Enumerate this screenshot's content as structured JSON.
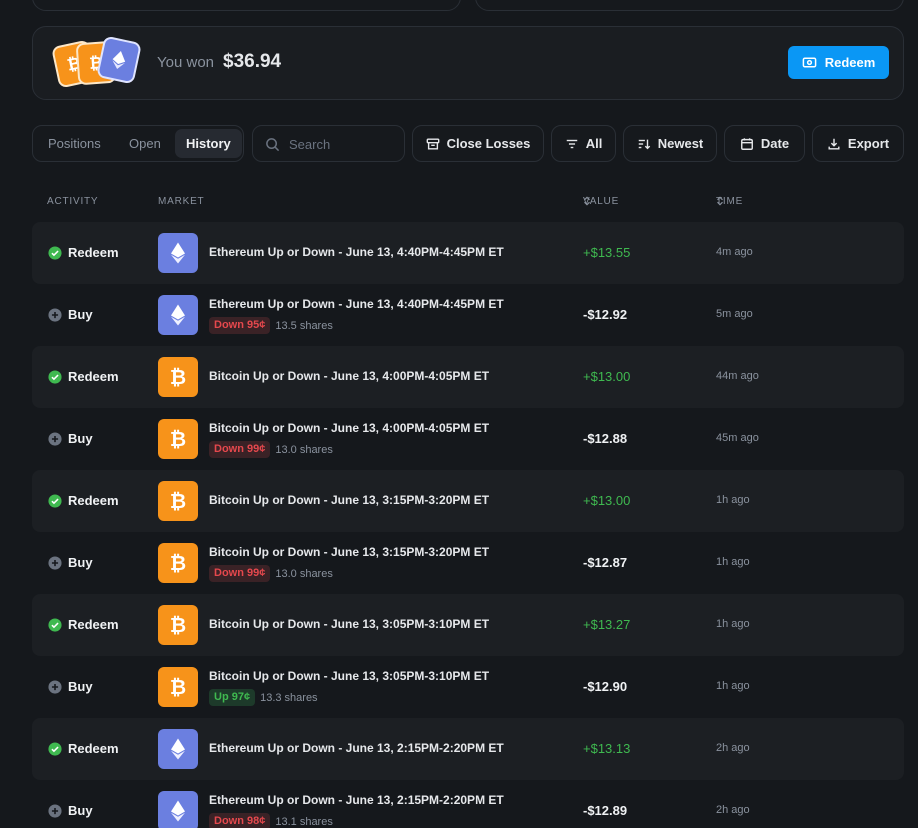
{
  "won": {
    "label": "You won",
    "amount": "$36.94",
    "redeem_label": "Redeem"
  },
  "tabs": [
    {
      "label": "Positions"
    },
    {
      "label": "Open"
    },
    {
      "label": "History"
    }
  ],
  "search": {
    "placeholder": "Search"
  },
  "toolbar": {
    "close_losses": "Close Losses",
    "all": "All",
    "newest": "Newest",
    "date": "Date",
    "export": "Export"
  },
  "table": {
    "headers": {
      "activity": "ACTIVITY",
      "market": "MARKET",
      "value": "VALUE",
      "time": "TIME"
    },
    "rows": [
      {
        "activity": "Redeem",
        "market": "Ethereum Up or Down - June 13, 4:40PM-4:45PM ET",
        "value": "+$13.55",
        "time": "4m ago"
      },
      {
        "activity": "Buy",
        "market": "Ethereum Up or Down - June 13, 4:40PM-4:45PM ET",
        "badge": "Down 95¢",
        "shares": "13.5 shares",
        "value": "-$12.92",
        "time": "5m ago"
      },
      {
        "activity": "Redeem",
        "market": "Bitcoin Up or Down - June 13, 4:00PM-4:05PM ET",
        "value": "+$13.00",
        "time": "44m ago"
      },
      {
        "activity": "Buy",
        "market": "Bitcoin Up or Down - June 13, 4:00PM-4:05PM ET",
        "badge": "Down 99¢",
        "shares": "13.0 shares",
        "value": "-$12.88",
        "time": "45m ago"
      },
      {
        "activity": "Redeem",
        "market": "Bitcoin Up or Down - June 13, 3:15PM-3:20PM ET",
        "value": "+$13.00",
        "time": "1h ago"
      },
      {
        "activity": "Buy",
        "market": "Bitcoin Up or Down - June 13, 3:15PM-3:20PM ET",
        "badge": "Down 99¢",
        "shares": "13.0 shares",
        "value": "-$12.87",
        "time": "1h ago"
      },
      {
        "activity": "Redeem",
        "market": "Bitcoin Up or Down - June 13, 3:05PM-3:10PM ET",
        "value": "+$13.27",
        "time": "1h ago"
      },
      {
        "activity": "Buy",
        "market": "Bitcoin Up or Down - June 13, 3:05PM-3:10PM ET",
        "badge": "Up 97¢",
        "shares": "13.3 shares",
        "value": "-$12.90",
        "time": "1h ago"
      },
      {
        "activity": "Redeem",
        "market": "Ethereum Up or Down - June 13, 2:15PM-2:20PM ET",
        "value": "+$13.13",
        "time": "2h ago"
      },
      {
        "activity": "Buy",
        "market": "Ethereum Up or Down - June 13, 2:15PM-2:20PM ET",
        "badge": "Down 98¢",
        "shares": "13.1 shares",
        "value": "-$12.89",
        "time": "2h ago"
      }
    ]
  },
  "icons": {
    "row_0": "ethereum-icon",
    "row_1": "ethereum-icon",
    "row_2": "bitcoin-icon",
    "row_3": "bitcoin-icon",
    "row_4": "bitcoin-icon",
    "row_5": "bitcoin-icon",
    "row_6": "bitcoin-icon",
    "row_7": "bitcoin-icon",
    "row_8": "ethereum-icon",
    "row_9": "ethereum-icon"
  },
  "colors": {
    "background": "#15181c",
    "accent": "#0a97f5",
    "positive": "#3fb950",
    "negative_badge": "#e5484d",
    "bitcoin": "#f7931a",
    "ethereum": "#6b7fe0"
  }
}
